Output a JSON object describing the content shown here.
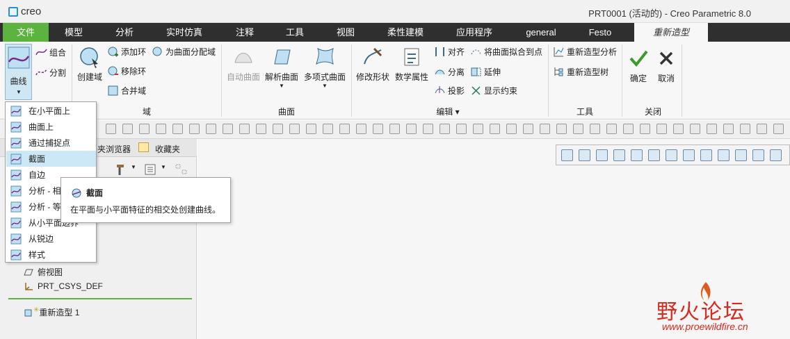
{
  "app": {
    "logo_text": "creo",
    "window_title": "PRT0001 (活动的) - Creo Parametric 8.0"
  },
  "tabs": [
    "文件",
    "模型",
    "分析",
    "实时仿真",
    "注释",
    "工具",
    "视图",
    "柔性建模",
    "应用程序",
    "general",
    "Festo",
    "重新造型"
  ],
  "ribbon": {
    "curve_btn": "曲线",
    "combine": "组合",
    "split": "分割",
    "create_domain": "创建域",
    "add_ring": "添加环",
    "remove_ring": "移除环",
    "merge_domain": "合并域",
    "assign_domain": "为曲面分配域",
    "group_domain": "域",
    "auto_surface": "自动曲面",
    "analytic_surface": "解析曲面",
    "poly_surface": "多项式曲面",
    "group_surface": "曲面",
    "modify_shape": "修改形状",
    "math_props": "数学属性",
    "align": "对齐",
    "separate": "分离",
    "project": "投影",
    "fit_to_points": "将曲面拟合到点",
    "extend": "延伸",
    "show_constraints": "显示约束",
    "group_edit": "编辑",
    "remodel_analysis": "重新造型分析",
    "remodel_tree": "重新造型树",
    "group_tools": "工具",
    "ok": "确定",
    "cancel": "取消",
    "group_close": "关闭"
  },
  "dropdown": {
    "items": [
      "在小平面上",
      "曲面上",
      "通过捕捉点",
      "截面",
      "自边",
      "分析 - 相",
      "分析 - 等",
      "从小平面边界",
      "从锐边",
      "样式"
    ],
    "highlighted": "截面"
  },
  "tooltip": {
    "title": "截面",
    "desc": "在平面与小平面特征的相交处创建曲线。"
  },
  "left_panel": {
    "tab_browser": "夹浏览器",
    "tab_favorites": "收藏夹",
    "tree": [
      "俯视图",
      "PRT_CSYS_DEF"
    ],
    "remodel_item": "重新造型 1"
  },
  "watermark": {
    "text_cn": "野火论坛",
    "url": "www.proewildfire.cn"
  },
  "colors": {
    "accent_green": "#5db33f",
    "tab_bar": "#2f2f2f",
    "highlight": "#cce8f6",
    "logo_blue": "#2a8fd0"
  }
}
